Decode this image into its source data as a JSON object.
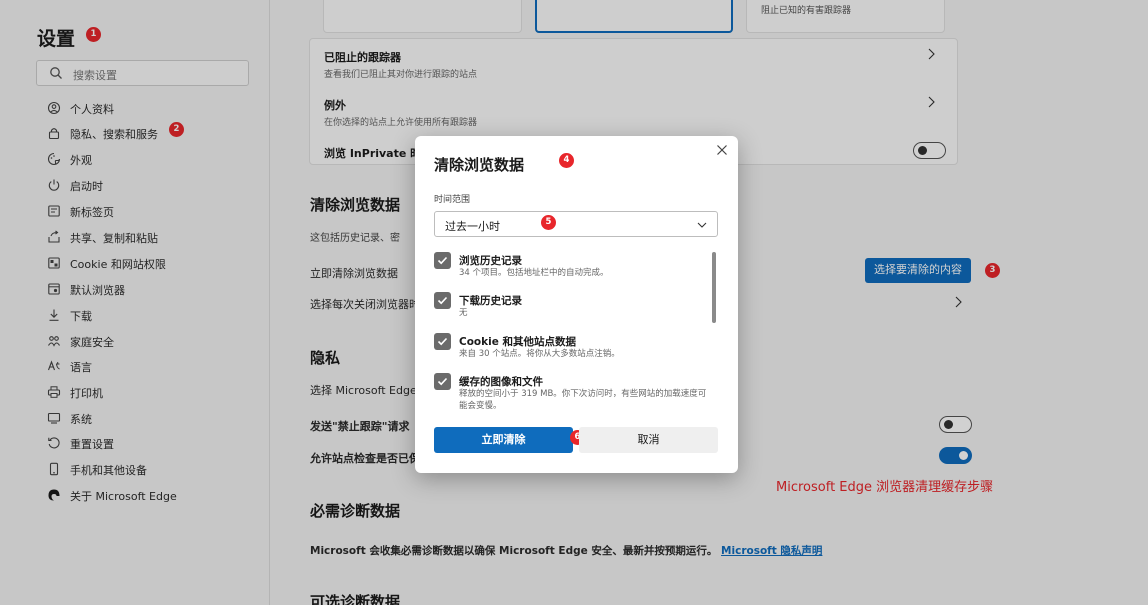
{
  "sidebar": {
    "title": "设置",
    "search_placeholder": "搜索设置",
    "items": [
      {
        "label": "个人资料",
        "icon": "profile-icon"
      },
      {
        "label": "隐私、搜索和服务",
        "icon": "lock-icon"
      },
      {
        "label": "外观",
        "icon": "appearance-icon"
      },
      {
        "label": "启动时",
        "icon": "power-icon"
      },
      {
        "label": "新标签页",
        "icon": "new-tab-icon"
      },
      {
        "label": "共享、复制和粘贴",
        "icon": "share-icon"
      },
      {
        "label": "Cookie 和网站权限",
        "icon": "cookie-icon"
      },
      {
        "label": "默认浏览器",
        "icon": "browser-icon"
      },
      {
        "label": "下载",
        "icon": "download-icon"
      },
      {
        "label": "家庭安全",
        "icon": "family-icon"
      },
      {
        "label": "语言",
        "icon": "language-icon"
      },
      {
        "label": "打印机",
        "icon": "printer-icon"
      },
      {
        "label": "系统",
        "icon": "system-icon"
      },
      {
        "label": "重置设置",
        "icon": "reset-icon"
      },
      {
        "label": "手机和其他设备",
        "icon": "phone-icon"
      },
      {
        "label": "关于 Microsoft Edge",
        "icon": "edge-icon"
      }
    ]
  },
  "badges": [
    "1",
    "2",
    "3",
    "4",
    "5",
    "6"
  ],
  "tracking": {
    "top_card_text": "阻止已知的有害跟踪器",
    "blocked_title": "已阻止的跟踪器",
    "blocked_desc": "查看我们已阻止其对你进行跟踪的站点",
    "exceptions_title": "例外",
    "exceptions_desc": "在你选择的站点上允许使用所有跟踪器",
    "inprivate_title": "浏览 InPrivate 时"
  },
  "clear_section": {
    "title": "清除浏览数据",
    "desc": "这包括历史记录、密",
    "now_label": "立即清除浏览数据",
    "choose_button": "选择要清除的内容",
    "on_close_label": "选择每次关闭浏览器时"
  },
  "privacy_section": {
    "title": "隐私",
    "desc": "选择 Microsoft Edge",
    "dnt_label": "发送\"禁止跟踪\"请求",
    "payment_label": "允许站点检查是否已保"
  },
  "diagnostics": {
    "title": "必需诊断数据",
    "text": "Microsoft 会收集必需诊断数据以确保 Microsoft Edge 安全、最新并按预期运行。",
    "link": "Microsoft 隐私声明",
    "optional_title": "可选诊断数据"
  },
  "caption": "Microsoft Edge 浏览器清理缓存步骤",
  "dialog": {
    "title": "清除浏览数据",
    "time_range_label": "时间范围",
    "time_range_value": "过去一小时",
    "options": [
      {
        "title": "浏览历史记录",
        "desc": "34 个项目。包括地址栏中的自动完成。"
      },
      {
        "title": "下载历史记录",
        "desc": "无"
      },
      {
        "title": "Cookie 和其他站点数据",
        "desc": "来自 30 个站点。将你从大多数站点注销。"
      },
      {
        "title": "缓存的图像和文件",
        "desc": "释放的空间小于 319 MB。你下次访问时，有些网站的加载速度可能会变慢。"
      }
    ],
    "clear_button": "立即清除",
    "cancel_button": "取消"
  },
  "colors": {
    "accent": "#0f6cbd",
    "badge": "#e8262b"
  }
}
